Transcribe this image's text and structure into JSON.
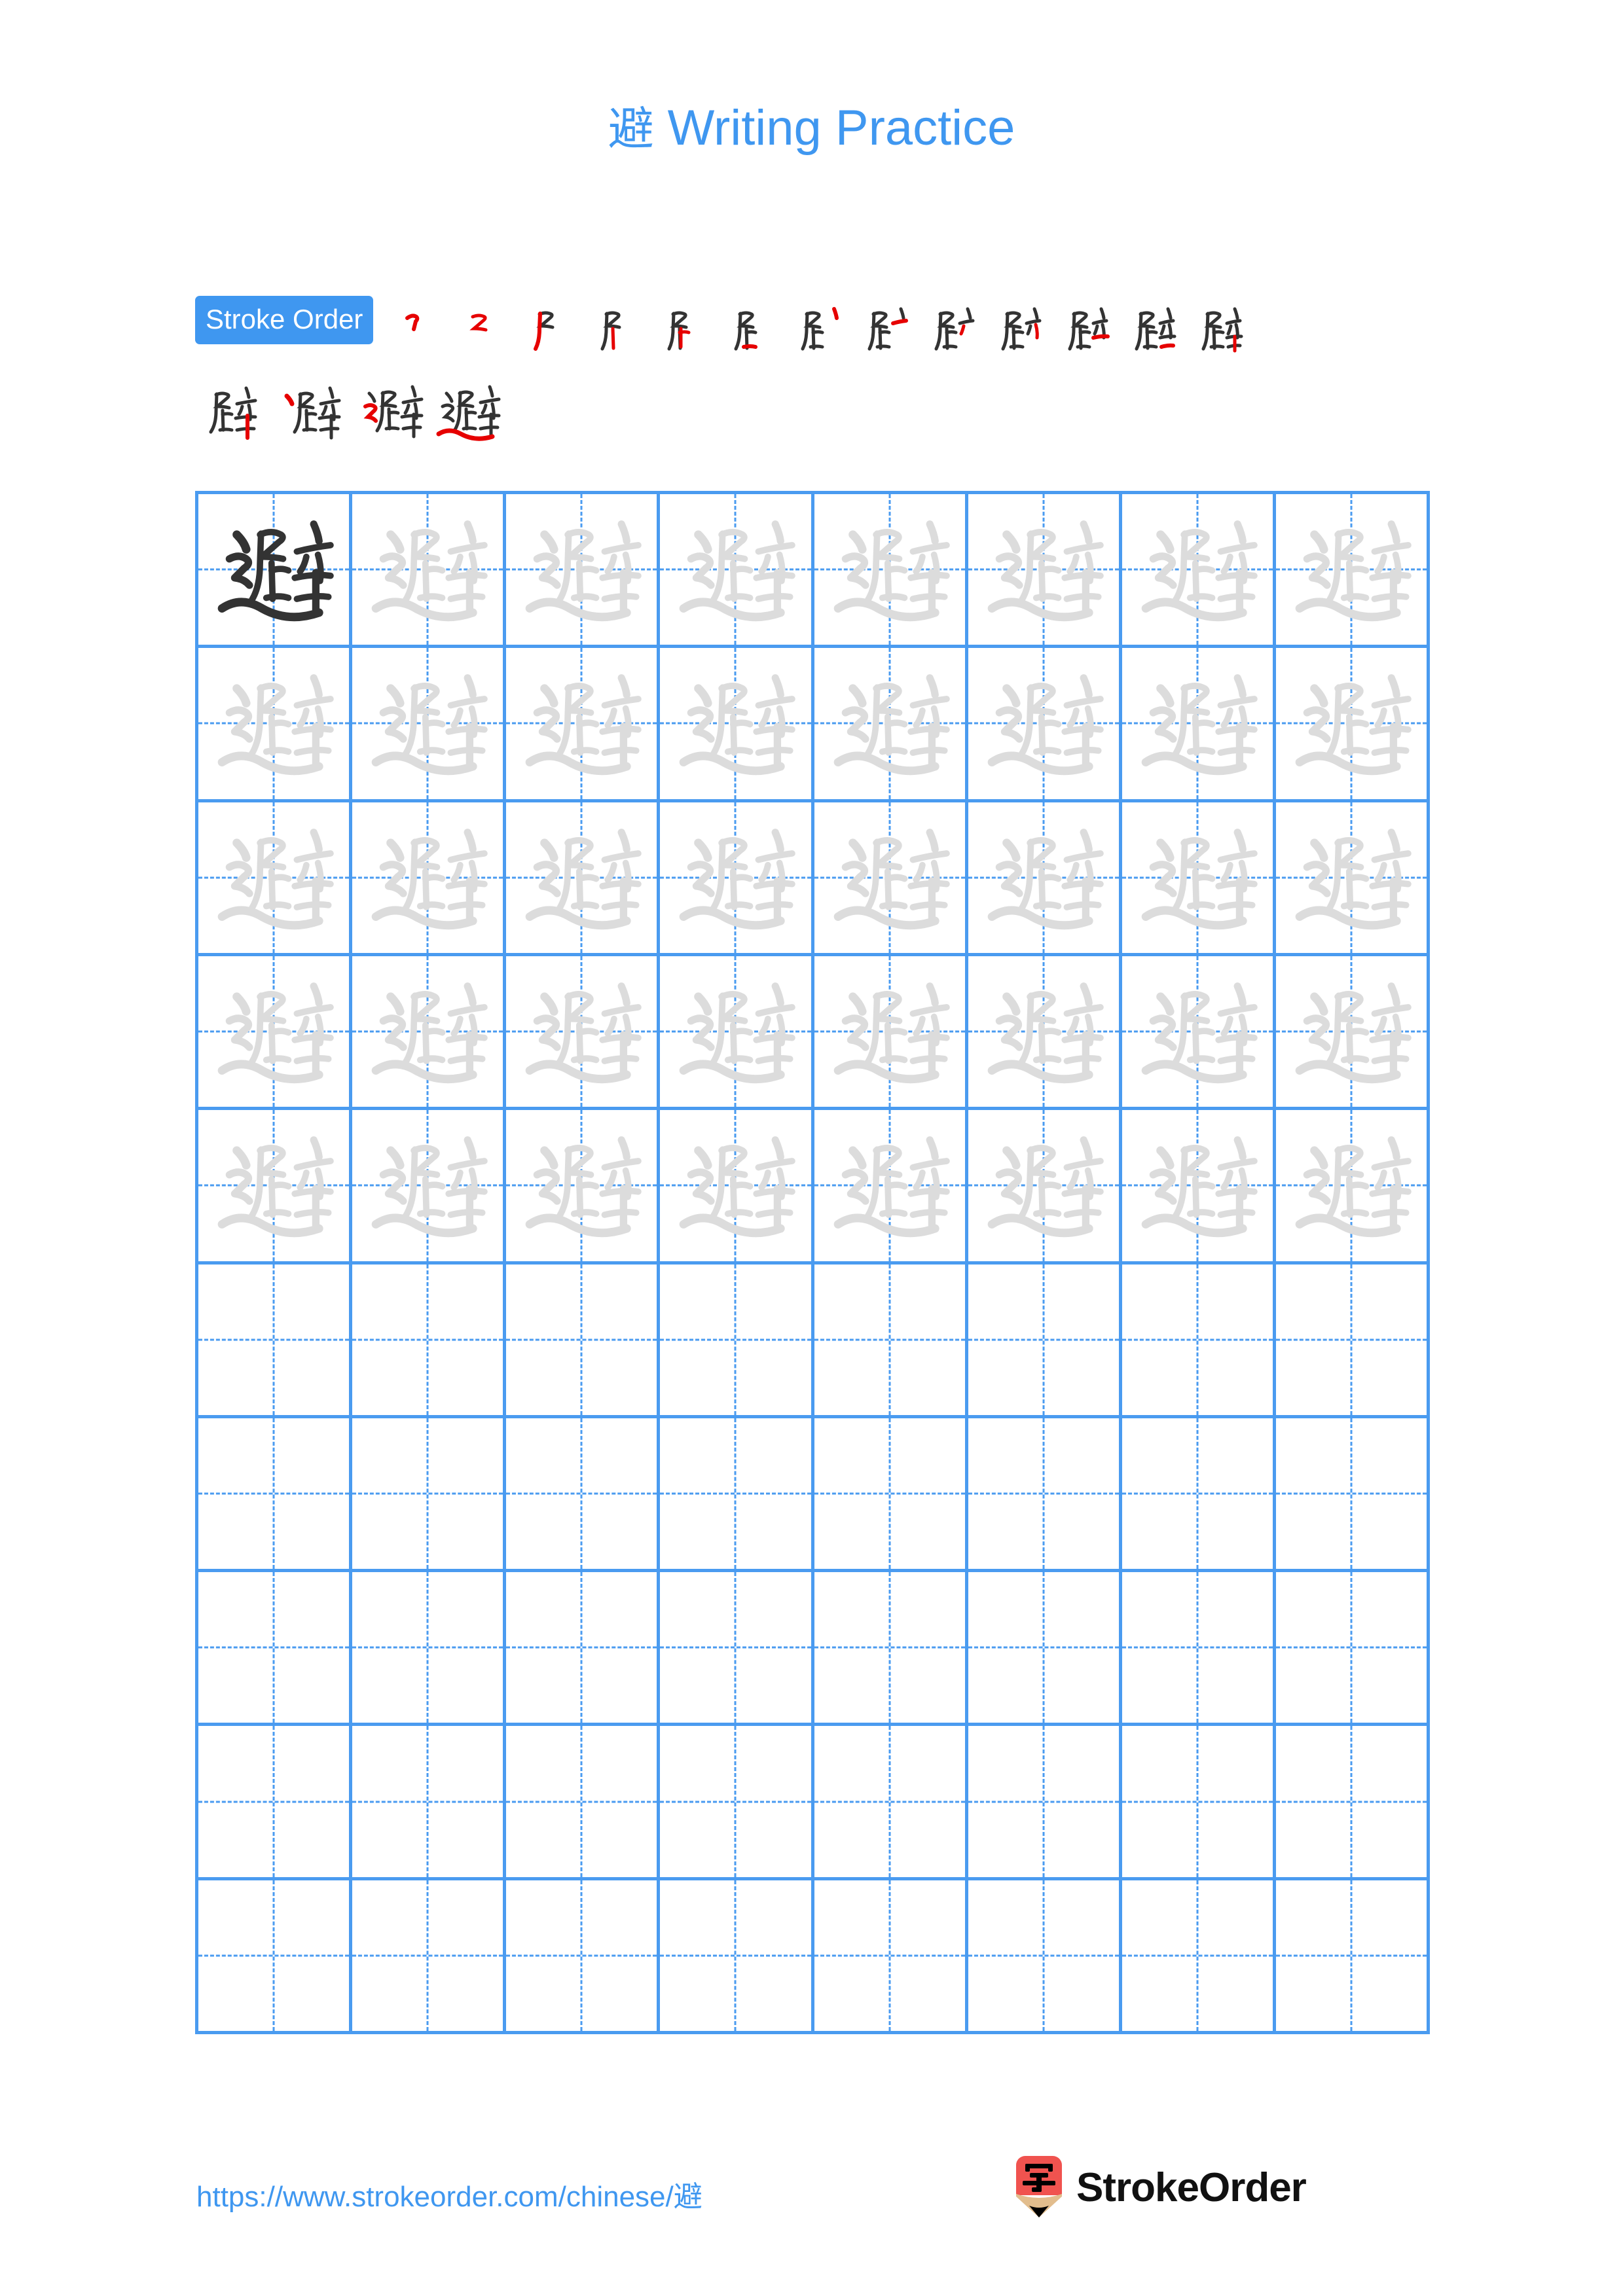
{
  "page": {
    "character": "避",
    "background_color": "#ffffff",
    "accent_color": "#3f97f0",
    "grid_line_color": "#4a9bf0",
    "model_glyph_color": "#333333",
    "trace_glyph_color": "#dcdcdc",
    "new_stroke_color": "#e60000",
    "existing_stroke_color": "#333333"
  },
  "header": {
    "title_char": "避",
    "title_text": " Writing Practice",
    "title_full": "避 Writing Practice"
  },
  "stroke_order": {
    "badge_label": "Stroke Order",
    "total_strokes": 17,
    "row1_steps": [
      {
        "index": 1,
        "partial": "丶"
      },
      {
        "index": 2,
        "partial": "乛"
      },
      {
        "index": 3,
        "partial": "尸"
      },
      {
        "index": 4,
        "partial": "尸"
      },
      {
        "index": 5,
        "partial": "艮"
      },
      {
        "index": 6,
        "partial": "启"
      },
      {
        "index": 7,
        "partial": "启"
      },
      {
        "index": 8,
        "partial": "启"
      },
      {
        "index": 9,
        "partial": "启"
      },
      {
        "index": 10,
        "partial": "启"
      },
      {
        "index": 11,
        "partial": "辟"
      },
      {
        "index": 12,
        "partial": "辟"
      },
      {
        "index": 13,
        "partial": "辟"
      }
    ],
    "row2_steps": [
      {
        "index": 14,
        "partial": "辟"
      },
      {
        "index": 15,
        "partial": "辟"
      },
      {
        "index": 16,
        "partial": "避"
      },
      {
        "index": 17,
        "partial": "避"
      }
    ]
  },
  "practice_grid": {
    "columns": 8,
    "rows": 10,
    "model_cell": {
      "row": 1,
      "column": 1,
      "character": "避"
    },
    "traced_rows": 5,
    "blank_rows": 5,
    "cell_character": "避"
  },
  "footer": {
    "url": "https://www.strokeorder.com/chinese/避",
    "brand": "StrokeOrder",
    "logo_character": "字",
    "logo_body_color": "#f0534f",
    "logo_wood_color": "#e2bd8d",
    "logo_tip_color": "#000000"
  }
}
